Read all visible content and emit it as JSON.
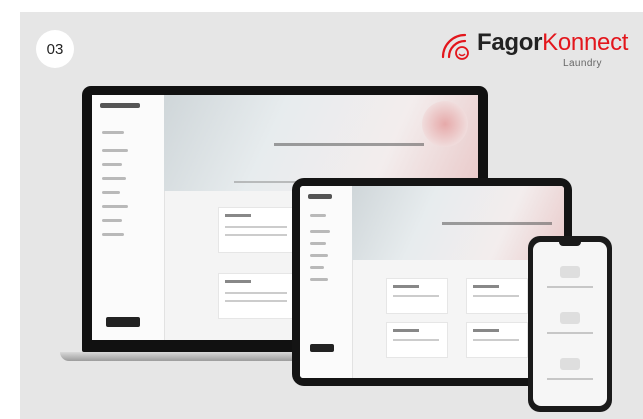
{
  "badge": {
    "number": "03"
  },
  "brand": {
    "name_dark": "Fagor",
    "name_red": "Konnect",
    "subtitle": "Laundry",
    "red_color": "#e3161c",
    "icon": "wifi-smile-icon"
  },
  "devices": {
    "laptop": "laptop-mockup",
    "tablet": "tablet-mockup",
    "phone": "phone-mockup"
  },
  "colors": {
    "background": "#e6e6e6",
    "device_frame": "#111111"
  }
}
